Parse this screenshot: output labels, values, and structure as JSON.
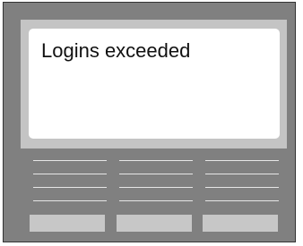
{
  "screen": {
    "message": "Logins exceeded"
  },
  "soft_keys": [
    {
      "label": ""
    },
    {
      "label": ""
    },
    {
      "label": ""
    }
  ],
  "colors": {
    "device_body": "#808080",
    "bezel": "#c4c4c4",
    "screen_background": "#ffffff",
    "key": "#c7c7c7",
    "menu_line": "#e6e6e6"
  }
}
